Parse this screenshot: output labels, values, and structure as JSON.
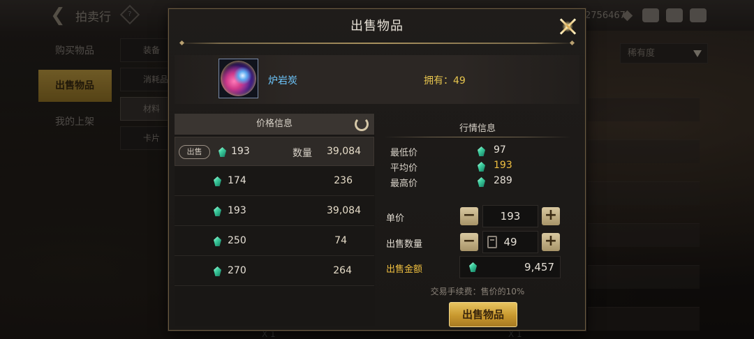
{
  "background": {
    "app_title": "拍卖行",
    "currency_partial": "2756467",
    "left_tabs": [
      "购买物品",
      "出售物品",
      "我的上架"
    ],
    "sub_tabs": [
      "装备",
      "消耗品",
      "材料",
      "卡片"
    ],
    "sort_label": "稀有度",
    "bottom_texts": [
      "X 1",
      "X 1"
    ]
  },
  "modal": {
    "title": "出售物品",
    "item": {
      "name": "炉岩炭",
      "owned_label": "拥有：49"
    },
    "price_panel": {
      "header": "价格信息",
      "selected": {
        "tag": "出售",
        "price": "193",
        "qty_label": "数量",
        "qty": "39,084"
      },
      "rows": [
        {
          "price": "174",
          "qty": "236"
        },
        {
          "price": "193",
          "qty": "39,084"
        },
        {
          "price": "250",
          "qty": "74"
        },
        {
          "price": "270",
          "qty": "264"
        }
      ]
    },
    "market": {
      "title": "行情信息",
      "min_label": "最低价",
      "min": "97",
      "avg_label": "平均价",
      "avg": "193",
      "max_label": "最高价",
      "max": "289"
    },
    "form": {
      "unit_price_label": "单价",
      "unit_price": "193",
      "quantity_label": "出售数量",
      "quantity": "49",
      "total_label": "出售金额",
      "total": "9,457",
      "fee_note": "交易手续费：售价的10%",
      "sell_button": "出售物品"
    }
  },
  "colors": {
    "accent_gold": "#f0c040",
    "item_name": "#6ec8ff",
    "gem": "#3fd0a0"
  }
}
